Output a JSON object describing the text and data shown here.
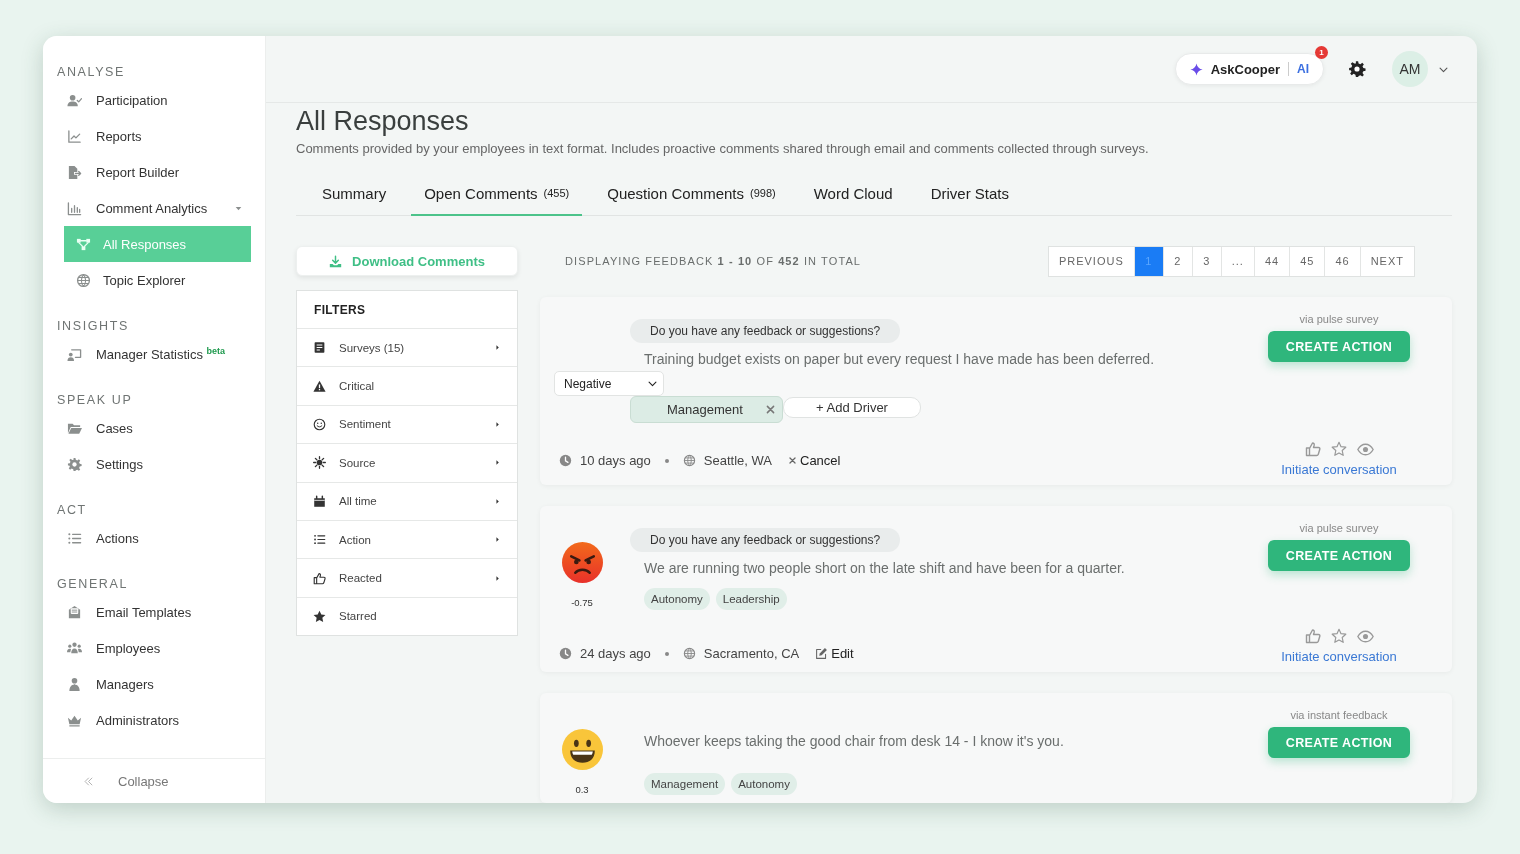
{
  "header": {
    "assistant": {
      "label": "AskCooper",
      "tag": "AI",
      "notifications": "1"
    },
    "avatar": "AM"
  },
  "sidebar": {
    "sections": [
      {
        "title": "ANALYSE",
        "items": [
          {
            "label": "Participation",
            "selected": false
          },
          {
            "label": "Reports",
            "selected": false
          },
          {
            "label": "Report Builder",
            "selected": false
          },
          {
            "label": "Comment Analytics",
            "selected": false,
            "expanded": true,
            "children": [
              {
                "label": "All Responses",
                "selected": true
              },
              {
                "label": "Topic Explorer",
                "selected": false
              }
            ]
          }
        ]
      },
      {
        "title": "INSIGHTS",
        "items": [
          {
            "label": "Manager Statistics $^{beta}$",
            "selected": false
          }
        ]
      },
      {
        "title": "SPEAK UP",
        "items": [
          {
            "label": "Cases",
            "selected": false
          },
          {
            "label": "Settings",
            "selected": false
          }
        ]
      },
      {
        "title": "ACT",
        "items": [
          {
            "label": "Actions",
            "selected": false
          }
        ]
      },
      {
        "title": "GENERAL",
        "items": [
          {
            "label": "Email Templates",
            "selected": false
          },
          {
            "label": "Employees",
            "selected": false
          },
          {
            "label": "Managers",
            "selected": false
          },
          {
            "label": "Administrators",
            "selected": false
          }
        ]
      }
    ],
    "collapse": "Collapse"
  },
  "page": {
    "title": "All Responses",
    "subtitle": "Comments provided by your employees in text format. Includes proactive comments shared through email and comments collected through surveys."
  },
  "tabs": [
    {
      "label": "Summary",
      "selected": false
    },
    {
      "label": "Open Comments",
      "count": "(455)",
      "selected": true
    },
    {
      "label": "Question Comments",
      "count": "(998)",
      "selected": false
    },
    {
      "label": "Word Cloud",
      "selected": false
    },
    {
      "label": "Driver Stats",
      "selected": false
    }
  ],
  "download_button": "Download Comments",
  "filters": {
    "title": "FILTERS",
    "items": [
      {
        "label": "Surveys (15)",
        "submenu": true
      },
      {
        "label": "Critical",
        "submenu": false
      },
      {
        "label": "Sentiment",
        "submenu": true
      },
      {
        "label": "Source",
        "submenu": true
      },
      {
        "label": "All time",
        "submenu": true
      },
      {
        "label": "Action",
        "submenu": true
      },
      {
        "label": "Reacted",
        "submenu": true
      },
      {
        "label": "Starred",
        "submenu": false
      }
    ]
  },
  "summary": "DISPLAYING FEEDBACK **1 - 10** OF **452** IN TOTAL",
  "pagination": [
    {
      "label": "PREVIOUS",
      "selected": false
    },
    {
      "label": "1",
      "selected": true
    },
    {
      "label": "2",
      "selected": false
    },
    {
      "label": "3",
      "selected": false
    },
    {
      "label": "...",
      "selected": false
    },
    {
      "label": "44",
      "selected": false
    },
    {
      "label": "45",
      "selected": false
    },
    {
      "label": "46",
      "selected": false
    },
    {
      "label": "NEXT",
      "selected": false
    }
  ],
  "comments": [
    {
      "kind": "editing",
      "question": "Do you have any feedback or suggestions?",
      "text": "Training budget exists on paper but every request I have made has been deferred.",
      "sentiment_select": "Negative",
      "drivers": [
        "Management"
      ],
      "add_driver": "+ Add Driver",
      "time": "10 days ago",
      "location": "Seattle, WA",
      "action": "Cancel",
      "source": "via pulse survey",
      "button": "CREATE ACTION",
      "link": "Initiate conversation"
    },
    {
      "kind": "view",
      "negative": true,
      "score": "-0.75",
      "question": "Do you have any feedback or suggestions?",
      "text": "We are running two people short on the late shift and have been for a quarter.",
      "tags": [
        "Autonomy",
        "Leadership"
      ],
      "time": "24 days ago",
      "location": "Sacramento, CA",
      "action": "Edit",
      "source": "via pulse survey",
      "button": "CREATE ACTION",
      "link": "Initiate conversation"
    },
    {
      "kind": "view",
      "negative": false,
      "score": "0.3",
      "text": "Whoever keeps taking the good chair from desk 14 - I know it's you.",
      "tags": [
        "Management",
        "Autonomy"
      ],
      "source": "via instant feedback",
      "button": "CREATE ACTION"
    }
  ]
}
